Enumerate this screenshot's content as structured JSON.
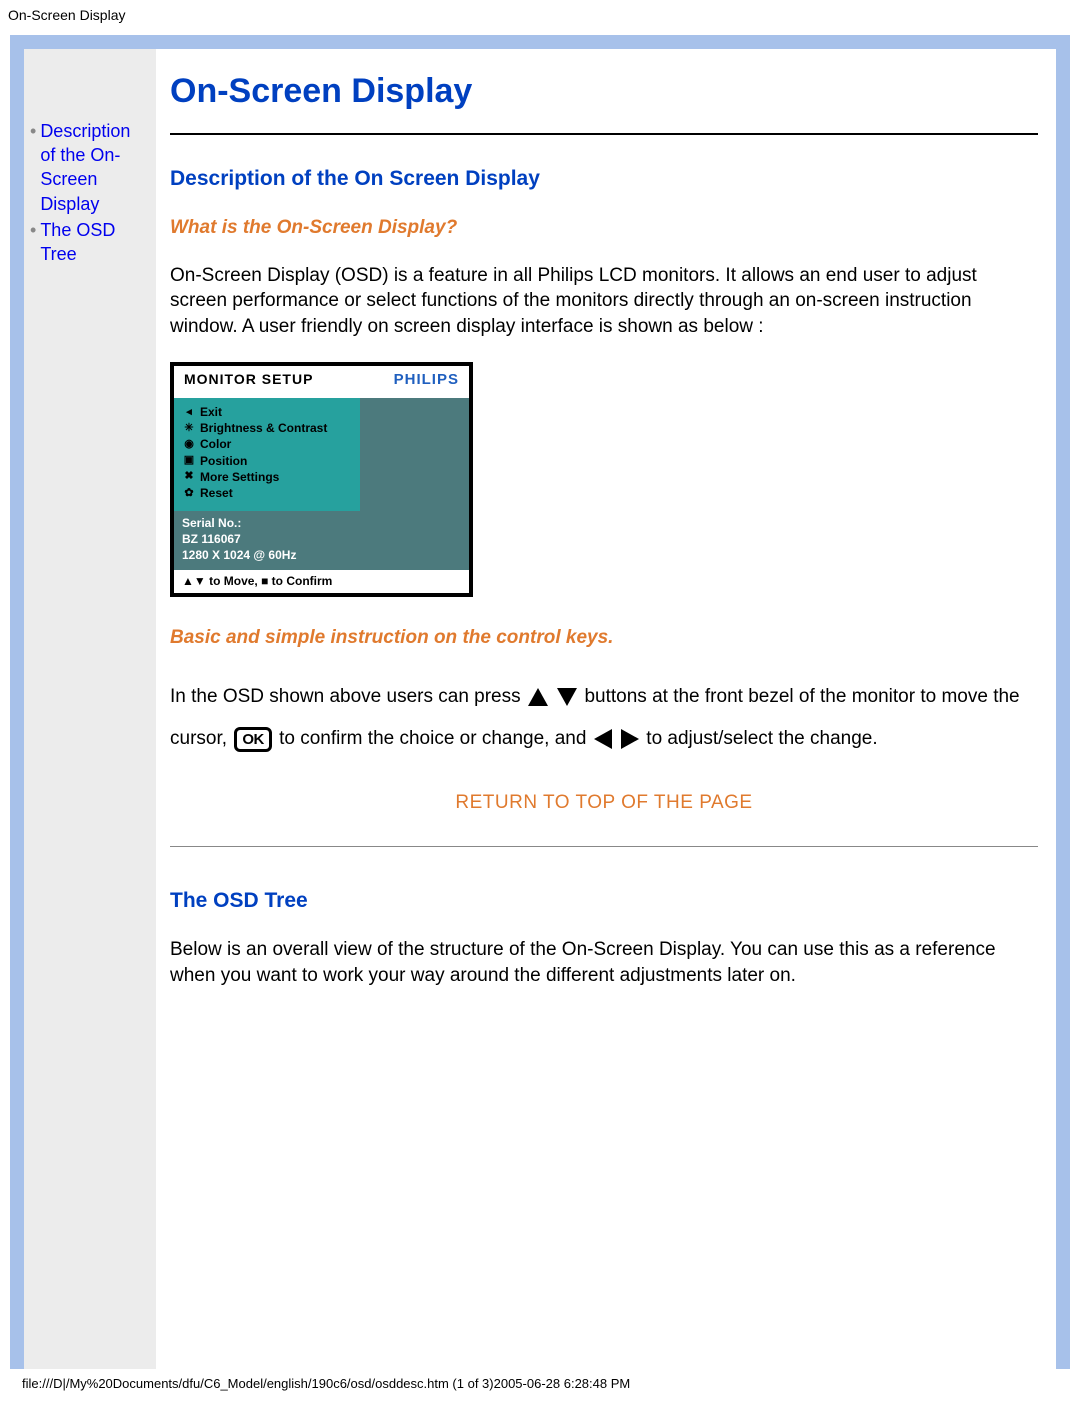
{
  "page_title_bar": "On-Screen Display",
  "nav": {
    "items": [
      {
        "label": "Description of the On-Screen Display"
      },
      {
        "label": "The OSD Tree"
      }
    ]
  },
  "main": {
    "title": "On-Screen Display",
    "section1": {
      "heading": "Description of the On Screen Display",
      "question": "What is the On-Screen Display?",
      "paragraph": "On-Screen Display (OSD) is a feature in all Philips LCD monitors. It allows an end user to adjust screen performance or select functions of the monitors directly through an on-screen instruction window. A user friendly on screen display interface is shown as below :"
    },
    "osd": {
      "setup_label": "MONITOR SETUP",
      "brand": "PHILIPS",
      "menu": [
        "Exit",
        "Brightness & Contrast",
        "Color",
        "Position",
        "More Settings",
        "Reset"
      ],
      "serial_label": "Serial No.:",
      "serial_value": "BZ 116067",
      "resolution": "1280 X 1024 @ 60Hz",
      "hint": "▲▼ to Move, ■ to Confirm"
    },
    "instruction_heading": "Basic and simple instruction on the control keys.",
    "instr": {
      "p1a": "In the OSD shown above users can press",
      "p1b": "buttons at the front bezel of the monitor to move the cursor,",
      "ok_label": "OK",
      "p1c": "to confirm the choice or change, and",
      "p1d": "to adjust/select the change."
    },
    "return_label": "RETURN TO TOP OF THE PAGE",
    "section2": {
      "heading": "The OSD Tree",
      "paragraph": "Below is an overall view of the structure of the On-Screen Display. You can use this as a reference when you want to work your way around the different adjustments later on."
    }
  },
  "footer_path": "file:///D|/My%20Documents/dfu/C6_Model/english/190c6/osd/osddesc.htm (1 of 3)2005-06-28 6:28:48 PM"
}
